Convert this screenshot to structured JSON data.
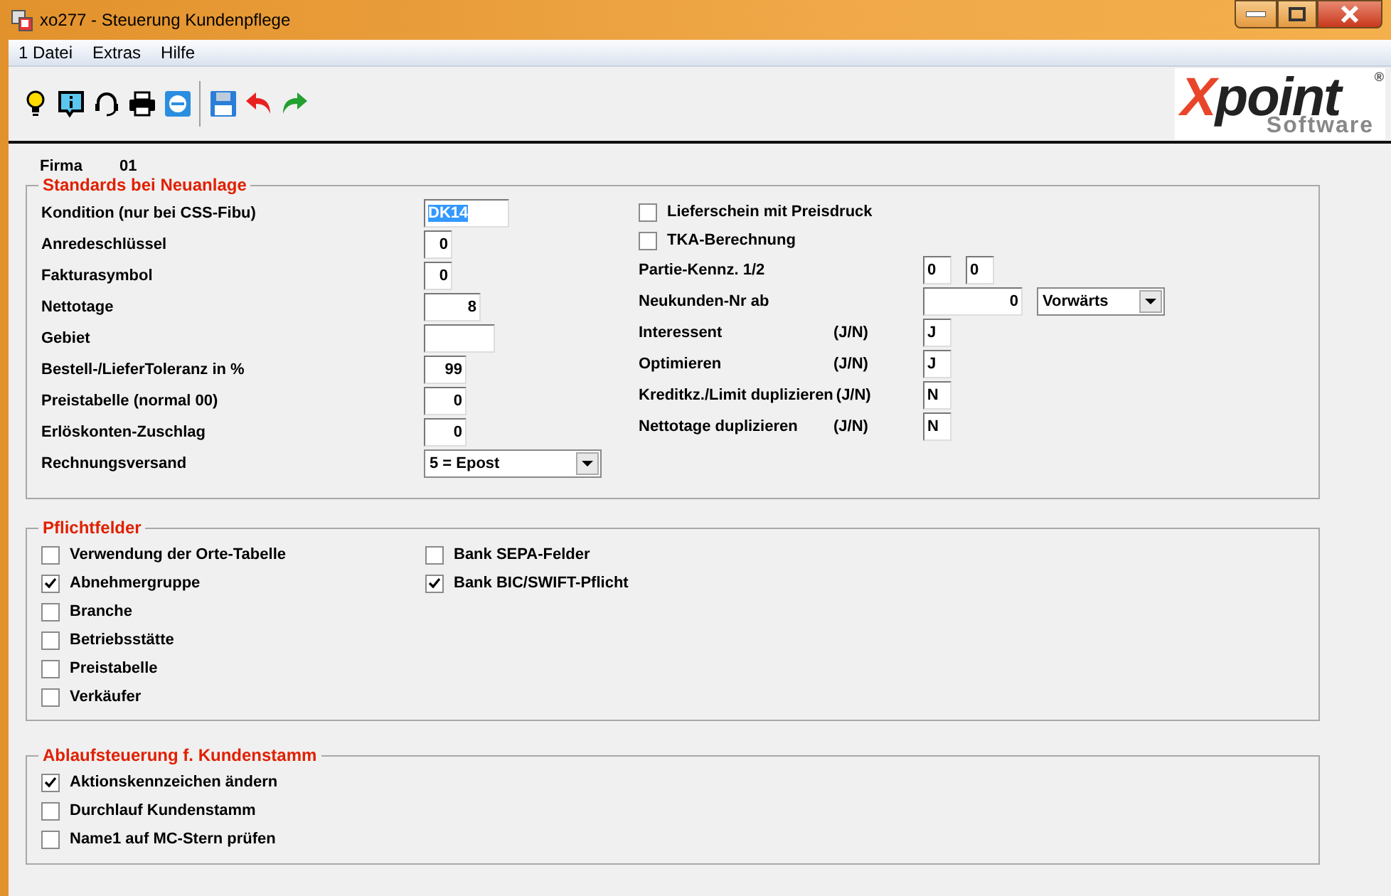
{
  "window": {
    "title": "xo277 - Steuerung Kundenpflege"
  },
  "menu": [
    "1 Datei",
    "Extras",
    "Hilfe"
  ],
  "logo": {
    "brand": "Xpoint",
    "registered": "®",
    "tagline": "Software"
  },
  "firma": {
    "label": "Firma",
    "value": "01"
  },
  "standards": {
    "title": "Standards bei Neuanlage",
    "left": [
      {
        "kind": "field",
        "label": "Kondition (nur bei CSS-Fibu)",
        "value": "DK14",
        "selected": true
      },
      {
        "kind": "field",
        "label": "Anredeschlüssel",
        "value": "0"
      },
      {
        "kind": "field",
        "label": "Fakturasymbol",
        "value": "0"
      },
      {
        "kind": "field",
        "label": "Nettotage",
        "value": "8"
      },
      {
        "kind": "field",
        "label": "Gebiet"
      },
      {
        "kind": "field",
        "label": "Bestell-/LieferToleranz in %",
        "value": "99"
      },
      {
        "kind": "field",
        "label": "Preistabelle (normal 00)",
        "value": "0"
      },
      {
        "kind": "field",
        "label": "Erlöskonten-Zuschlag",
        "value": "0"
      },
      {
        "kind": "select",
        "label": "Rechnungsversand",
        "value": "5 = Epost"
      }
    ],
    "right": [
      {
        "kind": "checkbox",
        "label": "Lieferschein mit Preisdruck",
        "checked": false
      },
      {
        "kind": "checkbox",
        "label": "TKA-Berechnung",
        "checked": false
      },
      {
        "kind": "pair",
        "label": "Partie-Kennz. 1/2",
        "values": [
          "0",
          "0"
        ]
      },
      {
        "kind": "number_select",
        "label": "Neukunden-Nr ab",
        "value": "0",
        "option": "Vorwärts"
      },
      {
        "kind": "yn",
        "label": "Interessent",
        "hint": "(J/N)",
        "value": "J"
      },
      {
        "kind": "yn",
        "label": "Optimieren",
        "hint": "(J/N)",
        "value": "J"
      },
      {
        "kind": "yn",
        "label": "Kreditkz./Limit duplizieren",
        "hint": "(J/N)",
        "value": "N"
      },
      {
        "kind": "yn",
        "label": "Nettotage duplizieren",
        "hint": "(J/N)",
        "value": "N"
      }
    ]
  },
  "pflichtfelder": {
    "title": "Pflichtfelder",
    "columns": [
      [
        {
          "label": "Verwendung der Orte-Tabelle",
          "checked": false
        },
        {
          "label": "Abnehmergruppe",
          "checked": true
        },
        {
          "label": "Branche",
          "checked": false
        },
        {
          "label": "Betriebsstätte",
          "checked": false
        },
        {
          "label": "Preistabelle",
          "checked": false
        },
        {
          "label": "Verkäufer",
          "checked": false
        }
      ],
      [
        {
          "label": "Bank SEPA-Felder",
          "checked": false
        },
        {
          "label": "Bank BIC/SWIFT-Pflicht",
          "checked": true
        }
      ]
    ]
  },
  "ablauf": {
    "title": "Ablaufsteuerung f. Kundenstamm",
    "items": [
      {
        "label": "Aktionskennzeichen ändern",
        "checked": true
      },
      {
        "label": "Durchlauf Kundenstamm",
        "checked": false
      },
      {
        "label": "Name1 auf MC-Stern prüfen",
        "checked": false
      }
    ]
  }
}
